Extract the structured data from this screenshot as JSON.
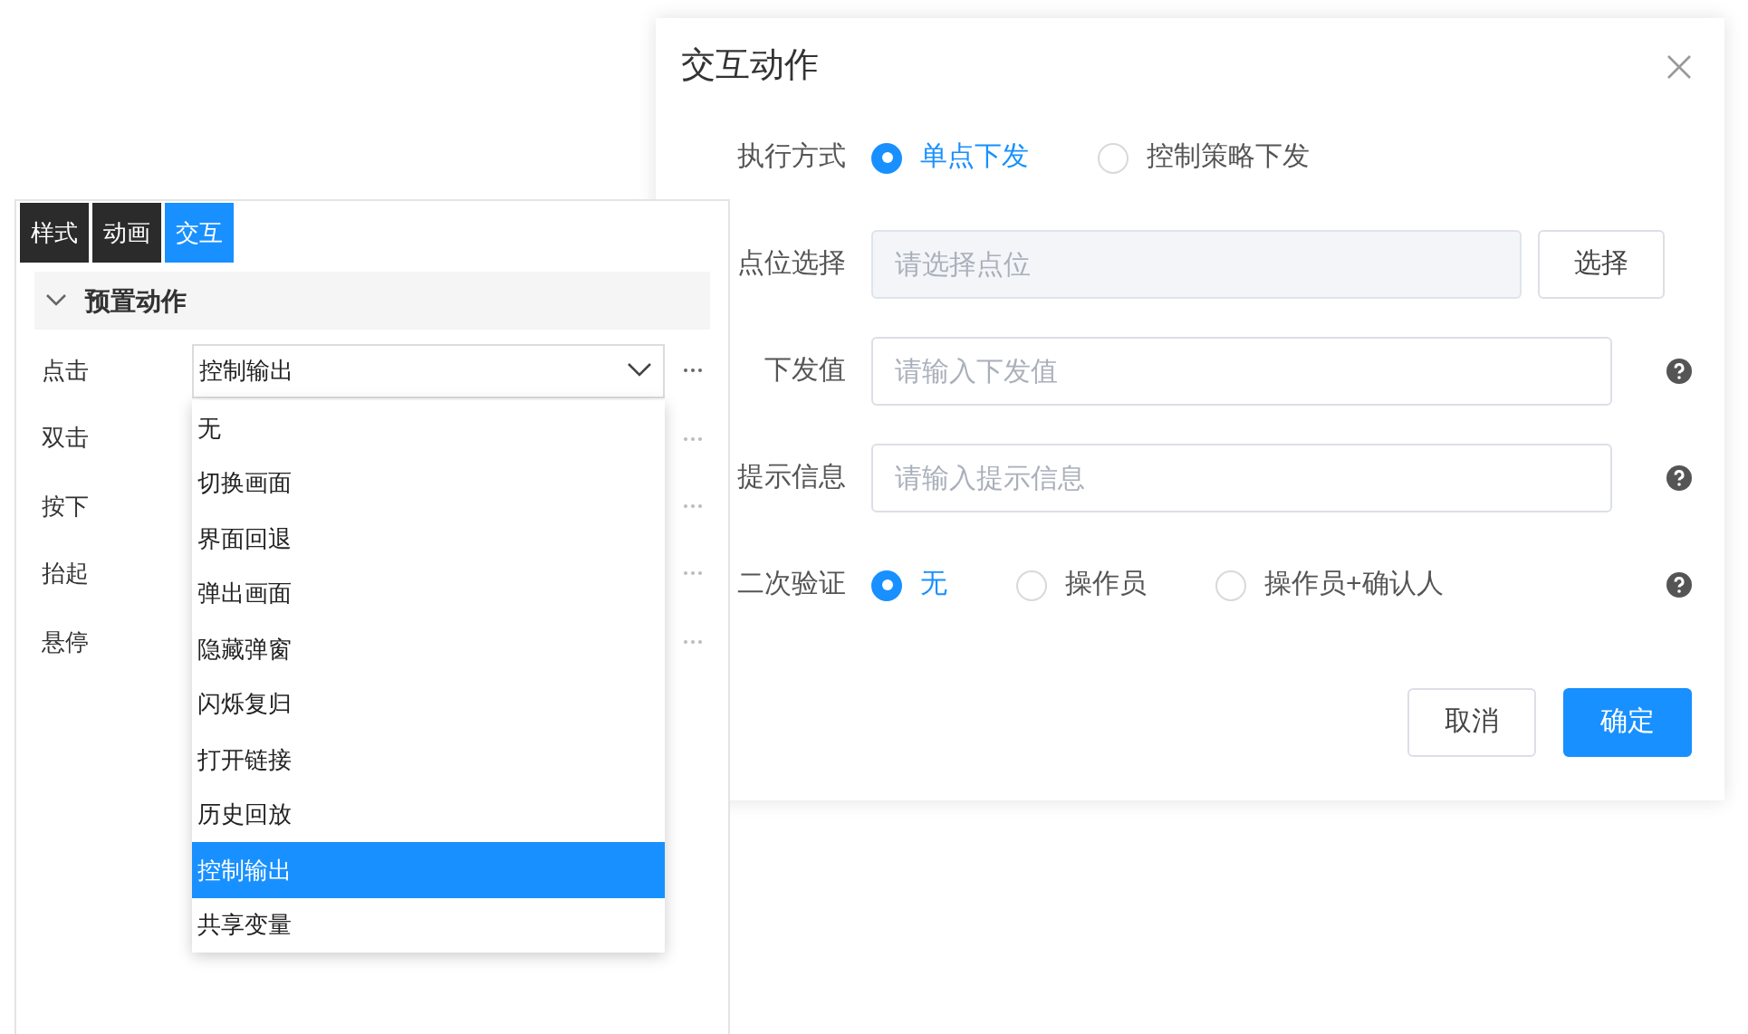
{
  "dialog": {
    "title": "交互动作",
    "fields": [
      {
        "kind": "radio",
        "label": "执行方式",
        "options": [
          {
            "label": "单点下发",
            "selected": true
          },
          {
            "label": "控制策略下发",
            "selected": false
          }
        ]
      },
      {
        "kind": "picker",
        "label": "点位选择",
        "placeholder": "请选择点位",
        "button": "选择"
      },
      {
        "kind": "input",
        "label": "下发值",
        "placeholder": "请输入下发值",
        "help": true
      },
      {
        "kind": "input",
        "label": "提示信息",
        "placeholder": "请输入提示信息",
        "help": true
      },
      {
        "kind": "radio",
        "label": "二次验证",
        "options": [
          {
            "label": "无",
            "selected": true
          },
          {
            "label": "操作员",
            "selected": false
          },
          {
            "label": "操作员+确认人",
            "selected": false
          }
        ],
        "help": true
      }
    ],
    "buttons": [
      {
        "label": "取消",
        "kind": "default"
      },
      {
        "label": "确定",
        "kind": "primary"
      }
    ]
  },
  "panel": {
    "tabs": [
      {
        "label": "样式",
        "selected": false
      },
      {
        "label": "动画",
        "selected": false
      },
      {
        "label": "交互",
        "selected": true
      }
    ],
    "section": {
      "title": "预置动作",
      "expanded": true
    },
    "events": [
      {
        "label": "点击",
        "value": "控制输出"
      },
      {
        "label": "双击"
      },
      {
        "label": "按下"
      },
      {
        "label": "抬起"
      },
      {
        "label": "悬停"
      }
    ],
    "dropdown": [
      {
        "label": "无",
        "selected": false
      },
      {
        "label": "切换画面",
        "selected": false
      },
      {
        "label": "界面回退",
        "selected": false
      },
      {
        "label": "弹出画面",
        "selected": false
      },
      {
        "label": "隐藏弹窗",
        "selected": false
      },
      {
        "label": "闪烁复归",
        "selected": false
      },
      {
        "label": "打开链接",
        "selected": false
      },
      {
        "label": "历史回放",
        "selected": false
      },
      {
        "label": "控制输出",
        "selected": true
      },
      {
        "label": "共享变量",
        "selected": false
      }
    ]
  }
}
